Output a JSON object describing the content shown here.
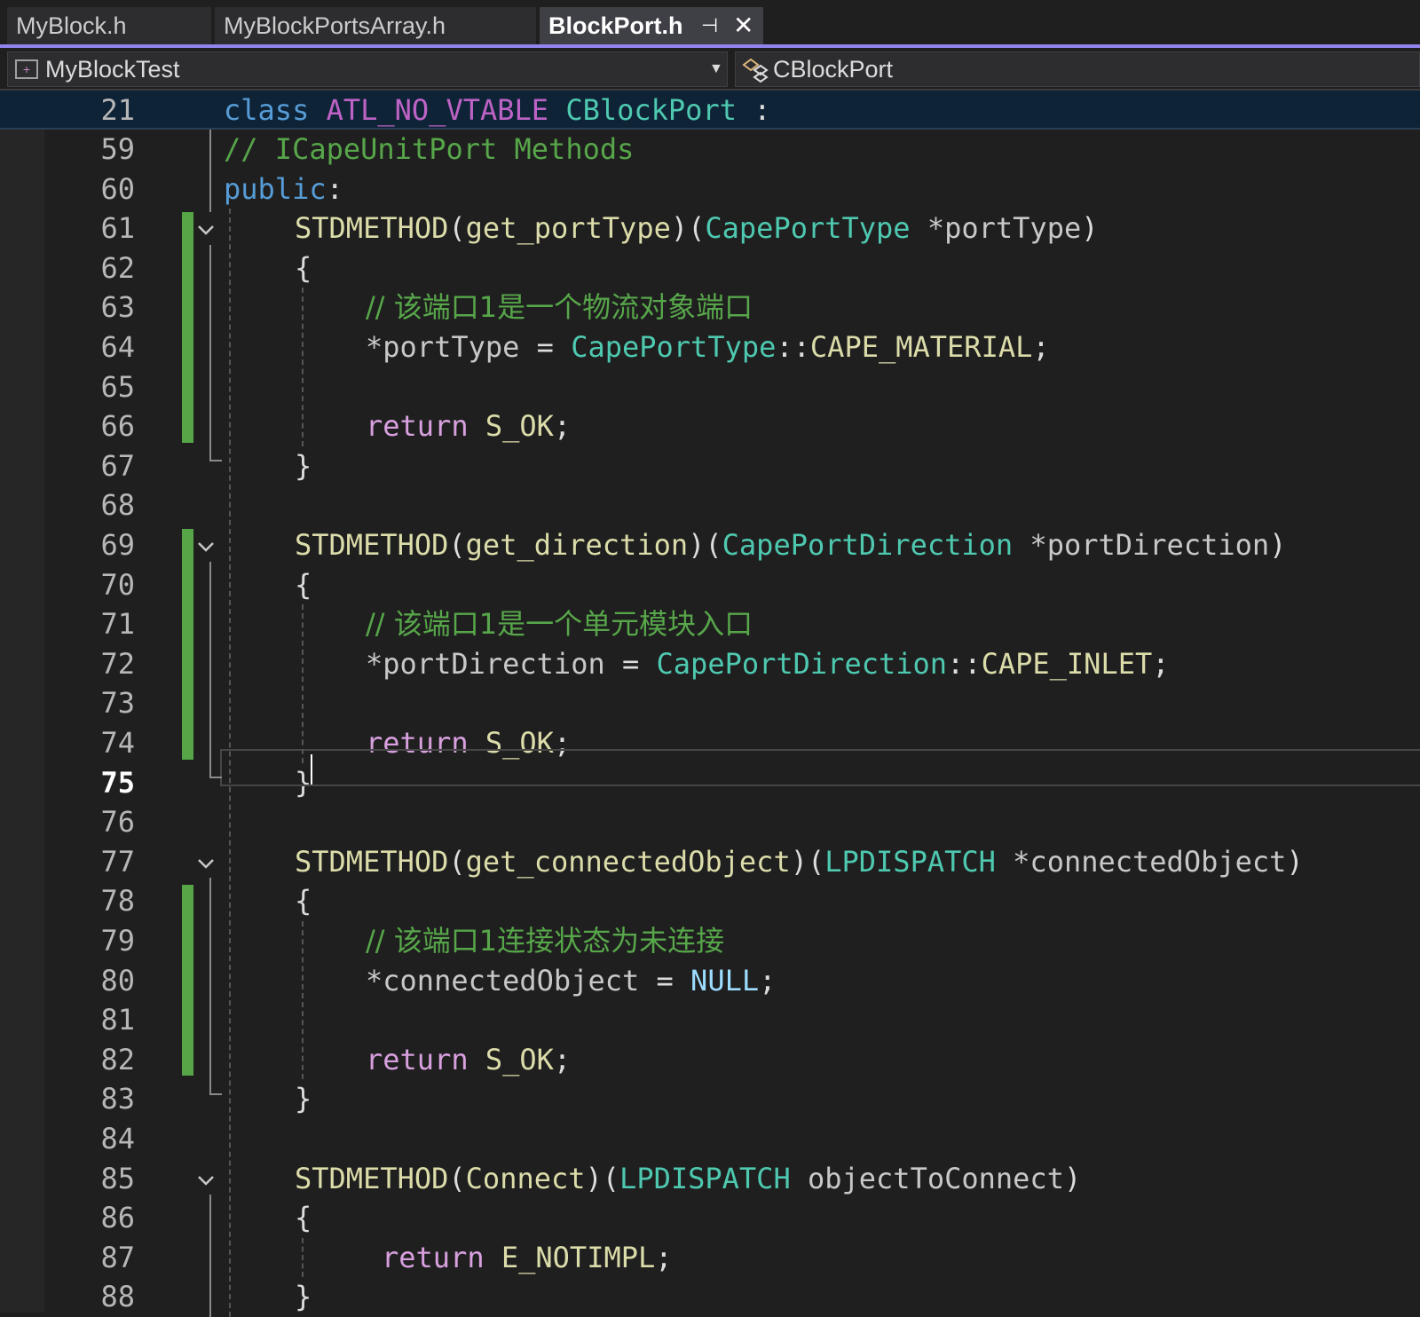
{
  "tabs": [
    {
      "label": "MyBlock.h"
    },
    {
      "label": "MyBlockPortsArray.h"
    },
    {
      "label": "BlockPort.h",
      "pin": "⊣",
      "close": "✕"
    }
  ],
  "nav": {
    "project": "MyBlockTest",
    "scope": "CBlockPort"
  },
  "sticky": {
    "line": "21",
    "tokens": [
      "class",
      "ATL_NO_VTABLE",
      "CBlockPort",
      ":"
    ]
  },
  "lines": [
    {
      "n": "59",
      "comment": "// ICapeUnitPort Methods"
    },
    {
      "n": "60",
      "kw": "public",
      "colon": ":"
    },
    {
      "n": "61",
      "macro": "STDMETHOD",
      "fn": "get_portType",
      "type": "CapePortType",
      "param": "*portType"
    },
    {
      "n": "62",
      "text": "{"
    },
    {
      "n": "63",
      "comment": "// 该端口1是一个物流对象端口"
    },
    {
      "n": "64",
      "lhs": "*portType",
      "op": "=",
      "type": "CapePortType",
      "sep": "::",
      "enum": "CAPE_MATERIAL",
      "end": ";"
    },
    {
      "n": "65"
    },
    {
      "n": "66",
      "ret": "return",
      "val": "S_OK",
      "end": ";"
    },
    {
      "n": "67",
      "text": "}"
    },
    {
      "n": "68"
    },
    {
      "n": "69",
      "macro": "STDMETHOD",
      "fn": "get_direction",
      "type": "CapePortDirection",
      "param": "*portDirection"
    },
    {
      "n": "70",
      "text": "{"
    },
    {
      "n": "71",
      "comment": "// 该端口1是一个单元模块入口"
    },
    {
      "n": "72",
      "lhs": "*portDirection",
      "op": "=",
      "type": "CapePortDirection",
      "sep": "::",
      "enum": "CAPE_INLET",
      "end": ";"
    },
    {
      "n": "73"
    },
    {
      "n": "74",
      "ret": "return",
      "val": "S_OK",
      "end": ";"
    },
    {
      "n": "75",
      "text": "}"
    },
    {
      "n": "76"
    },
    {
      "n": "77",
      "macro": "STDMETHOD",
      "fn": "get_connectedObject",
      "type": "LPDISPATCH",
      "param": "*connectedObject"
    },
    {
      "n": "78",
      "text": "{"
    },
    {
      "n": "79",
      "comment": "// 该端口1连接状态为未连接"
    },
    {
      "n": "80",
      "lhs": "*connectedObject",
      "op": "=",
      "val": "NULL",
      "end": ";"
    },
    {
      "n": "81"
    },
    {
      "n": "82",
      "ret": "return",
      "val": "S_OK",
      "end": ";"
    },
    {
      "n": "83",
      "text": "}"
    },
    {
      "n": "84"
    },
    {
      "n": "85",
      "macro": "STDMETHOD",
      "fn": "Connect",
      "type": "LPDISPATCH",
      "param": "objectToConnect"
    },
    {
      "n": "86",
      "text": "{"
    },
    {
      "n": "87",
      "ret": "return",
      "val": "E_NOTIMPL",
      "end": ";"
    },
    {
      "n": "88",
      "text": "}"
    }
  ],
  "colors": {
    "background": "#1f1f1f",
    "tab_accent": "#9184ee",
    "change_bar": "#56a648",
    "sticky_bg": "#0f2337"
  }
}
